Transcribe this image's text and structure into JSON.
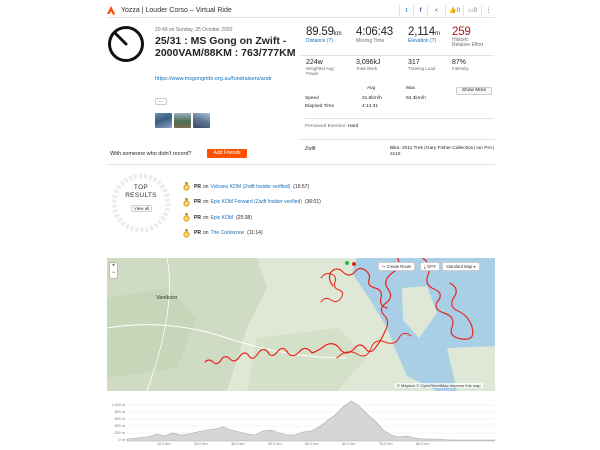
{
  "header": {
    "title": "Yozza | Louder Corso – Virtual Ride",
    "kudos_count": "0",
    "comments_count": "0",
    "colors": {
      "brand": "#fc4c02",
      "twitter": "#1da1f2",
      "facebook": "#3b5998"
    }
  },
  "activity": {
    "datetime": "20:49 on Sunday, 25 October 2020",
    "title": "25/31 : MS Gong on Zwift - 2000VAM/88KM : 763/777KM",
    "link": "https://www.msgongride.org.au/fundraisers/andr",
    "more_label": "...",
    "record_question": "With someone who didn't record?",
    "add_friends_label": "Add Friends"
  },
  "stats": {
    "distance": {
      "value": "89.59",
      "unit": "km",
      "label": "Distance (?)"
    },
    "moving_time": {
      "value": "4:06:43",
      "label": "Moving Time"
    },
    "elevation": {
      "value": "2,114",
      "unit": "m",
      "label": "Elevation (?)"
    },
    "relative_effort": {
      "value": "259",
      "label1": "Historic",
      "label2": "Relative Effort"
    },
    "power": {
      "value": "224w",
      "label1": "Weighted Avg",
      "label2": "Power"
    },
    "work": {
      "value": "3,096kJ",
      "label": "Total Work"
    },
    "training_load": {
      "value": "317",
      "label": "Training Load"
    },
    "intensity": {
      "value": "87%",
      "label": "Intensity"
    },
    "table": {
      "col_avg": "Avg",
      "col_max": "Max",
      "speed_label": "Speed",
      "speed_avg": "21.8km/h",
      "speed_max": "94.3km/h",
      "elapsed_label": "Elapsed Time",
      "elapsed_value": "4:14:31"
    },
    "show_more_label": "Show More",
    "exertion_label": "Perceived Exertion:",
    "exertion_value": "Hard",
    "device": "Zwift",
    "bike": "Bike: 2011 Trek (Gary Fisher Collection) Ion Pro | 2x10"
  },
  "top_results": {
    "title1": "TOP",
    "title2": "RESULTS",
    "view_all_label": "View all",
    "items": [
      {
        "pr": "PR",
        "on": "on",
        "segment": "Volcano KOM (Zwift Insider verified)",
        "time": "(16:57)"
      },
      {
        "pr": "PR",
        "on": "on",
        "segment": "Epic KOM Forward (Zwift Insider verified)",
        "time": "(36:01)"
      },
      {
        "pr": "PR",
        "on": "on",
        "segment": "Epic KOM",
        "time": "(25:38)"
      },
      {
        "pr": "PR",
        "on": "on",
        "segment": "The Corkscrew",
        "time": "(11:14)"
      }
    ]
  },
  "map": {
    "zoom_in": "+",
    "zoom_out": "−",
    "create_route": "Create Route",
    "gpx": "GPX",
    "standard_map": "Standard Map",
    "place_label": "Vanikoro",
    "attribution": "© Mapbox © OpenStreetMap Improve this map",
    "route_color": "#e8261c"
  },
  "elevation": {
    "y_ticks": [
      "1,000 m",
      "800 m",
      "600 m",
      "400 m",
      "200 m",
      "0 m"
    ],
    "x_ticks": [
      "10.0 km",
      "20.0 km",
      "30.0 km",
      "40.0 km",
      "50.0 km",
      "60.0 km",
      "70.0 km",
      "80.0 km"
    ]
  }
}
